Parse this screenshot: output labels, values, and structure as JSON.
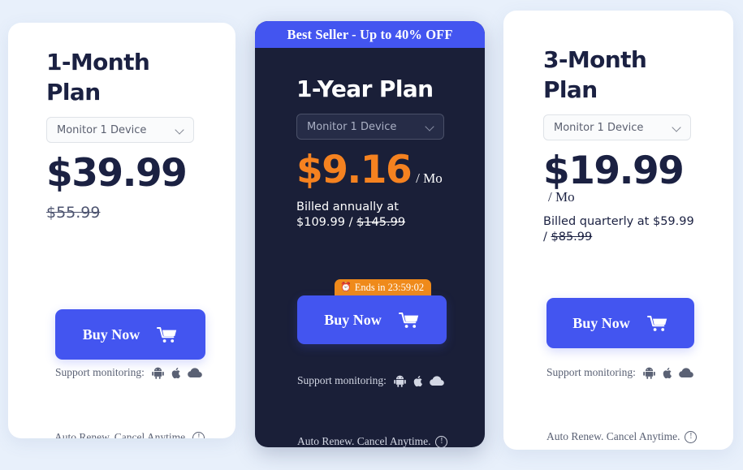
{
  "theme": {
    "page_background": "#e8f0fb",
    "accent_blue": "#4355f0",
    "accent_orange": "#f58220",
    "countdown_orange": "#ef8a1b",
    "dark_card": "#1a1f38",
    "heading_navy": "#1b2142"
  },
  "plans": [
    {
      "id": "1-month",
      "title": "1-Month Plan",
      "select_value": "Monitor 1 Device",
      "price": "$39.99",
      "price_suffix": "",
      "old_price": "$55.99",
      "billed_text": "",
      "buy_label": "Buy Now",
      "support_label": "Support monitoring:",
      "note": "Auto Renew. Cancel Anytime.",
      "featured": false
    },
    {
      "id": "1-year",
      "title": "1-Year Plan",
      "ribbon": "Best Seller - Up to 40% OFF",
      "select_value": "Monitor 1 Device",
      "price": "$9.16",
      "price_suffix": "/ Mo",
      "billed_prefix": "Billed annually at",
      "billed_now": "$109.99 /",
      "billed_old": "$145.99",
      "countdown_icon": "alarm-clock-icon",
      "countdown": "Ends in 23:59:02",
      "buy_label": "Buy Now",
      "support_label": "Support monitoring:",
      "note": "Auto Renew. Cancel Anytime.",
      "featured": true
    },
    {
      "id": "3-month",
      "title": "3-Month Plan",
      "select_value": "Monitor 1 Device",
      "price": "$19.99",
      "price_suffix": "/ Mo",
      "billed_prefix": "Billed quarterly at $59.99",
      "billed_now": "/",
      "billed_old": "$85.99",
      "buy_label": "Buy Now",
      "support_label": "Support monitoring:",
      "note": "Auto Renew. Cancel Anytime.",
      "featured": false
    }
  ],
  "icons": {
    "cart": "shopping-cart-icon",
    "android": "android-icon",
    "apple": "apple-icon",
    "cloud": "cloud-icon",
    "info": "info-icon",
    "chevron": "chevron-down-icon",
    "info_glyph": "!",
    "clock_glyph": "⏰"
  }
}
